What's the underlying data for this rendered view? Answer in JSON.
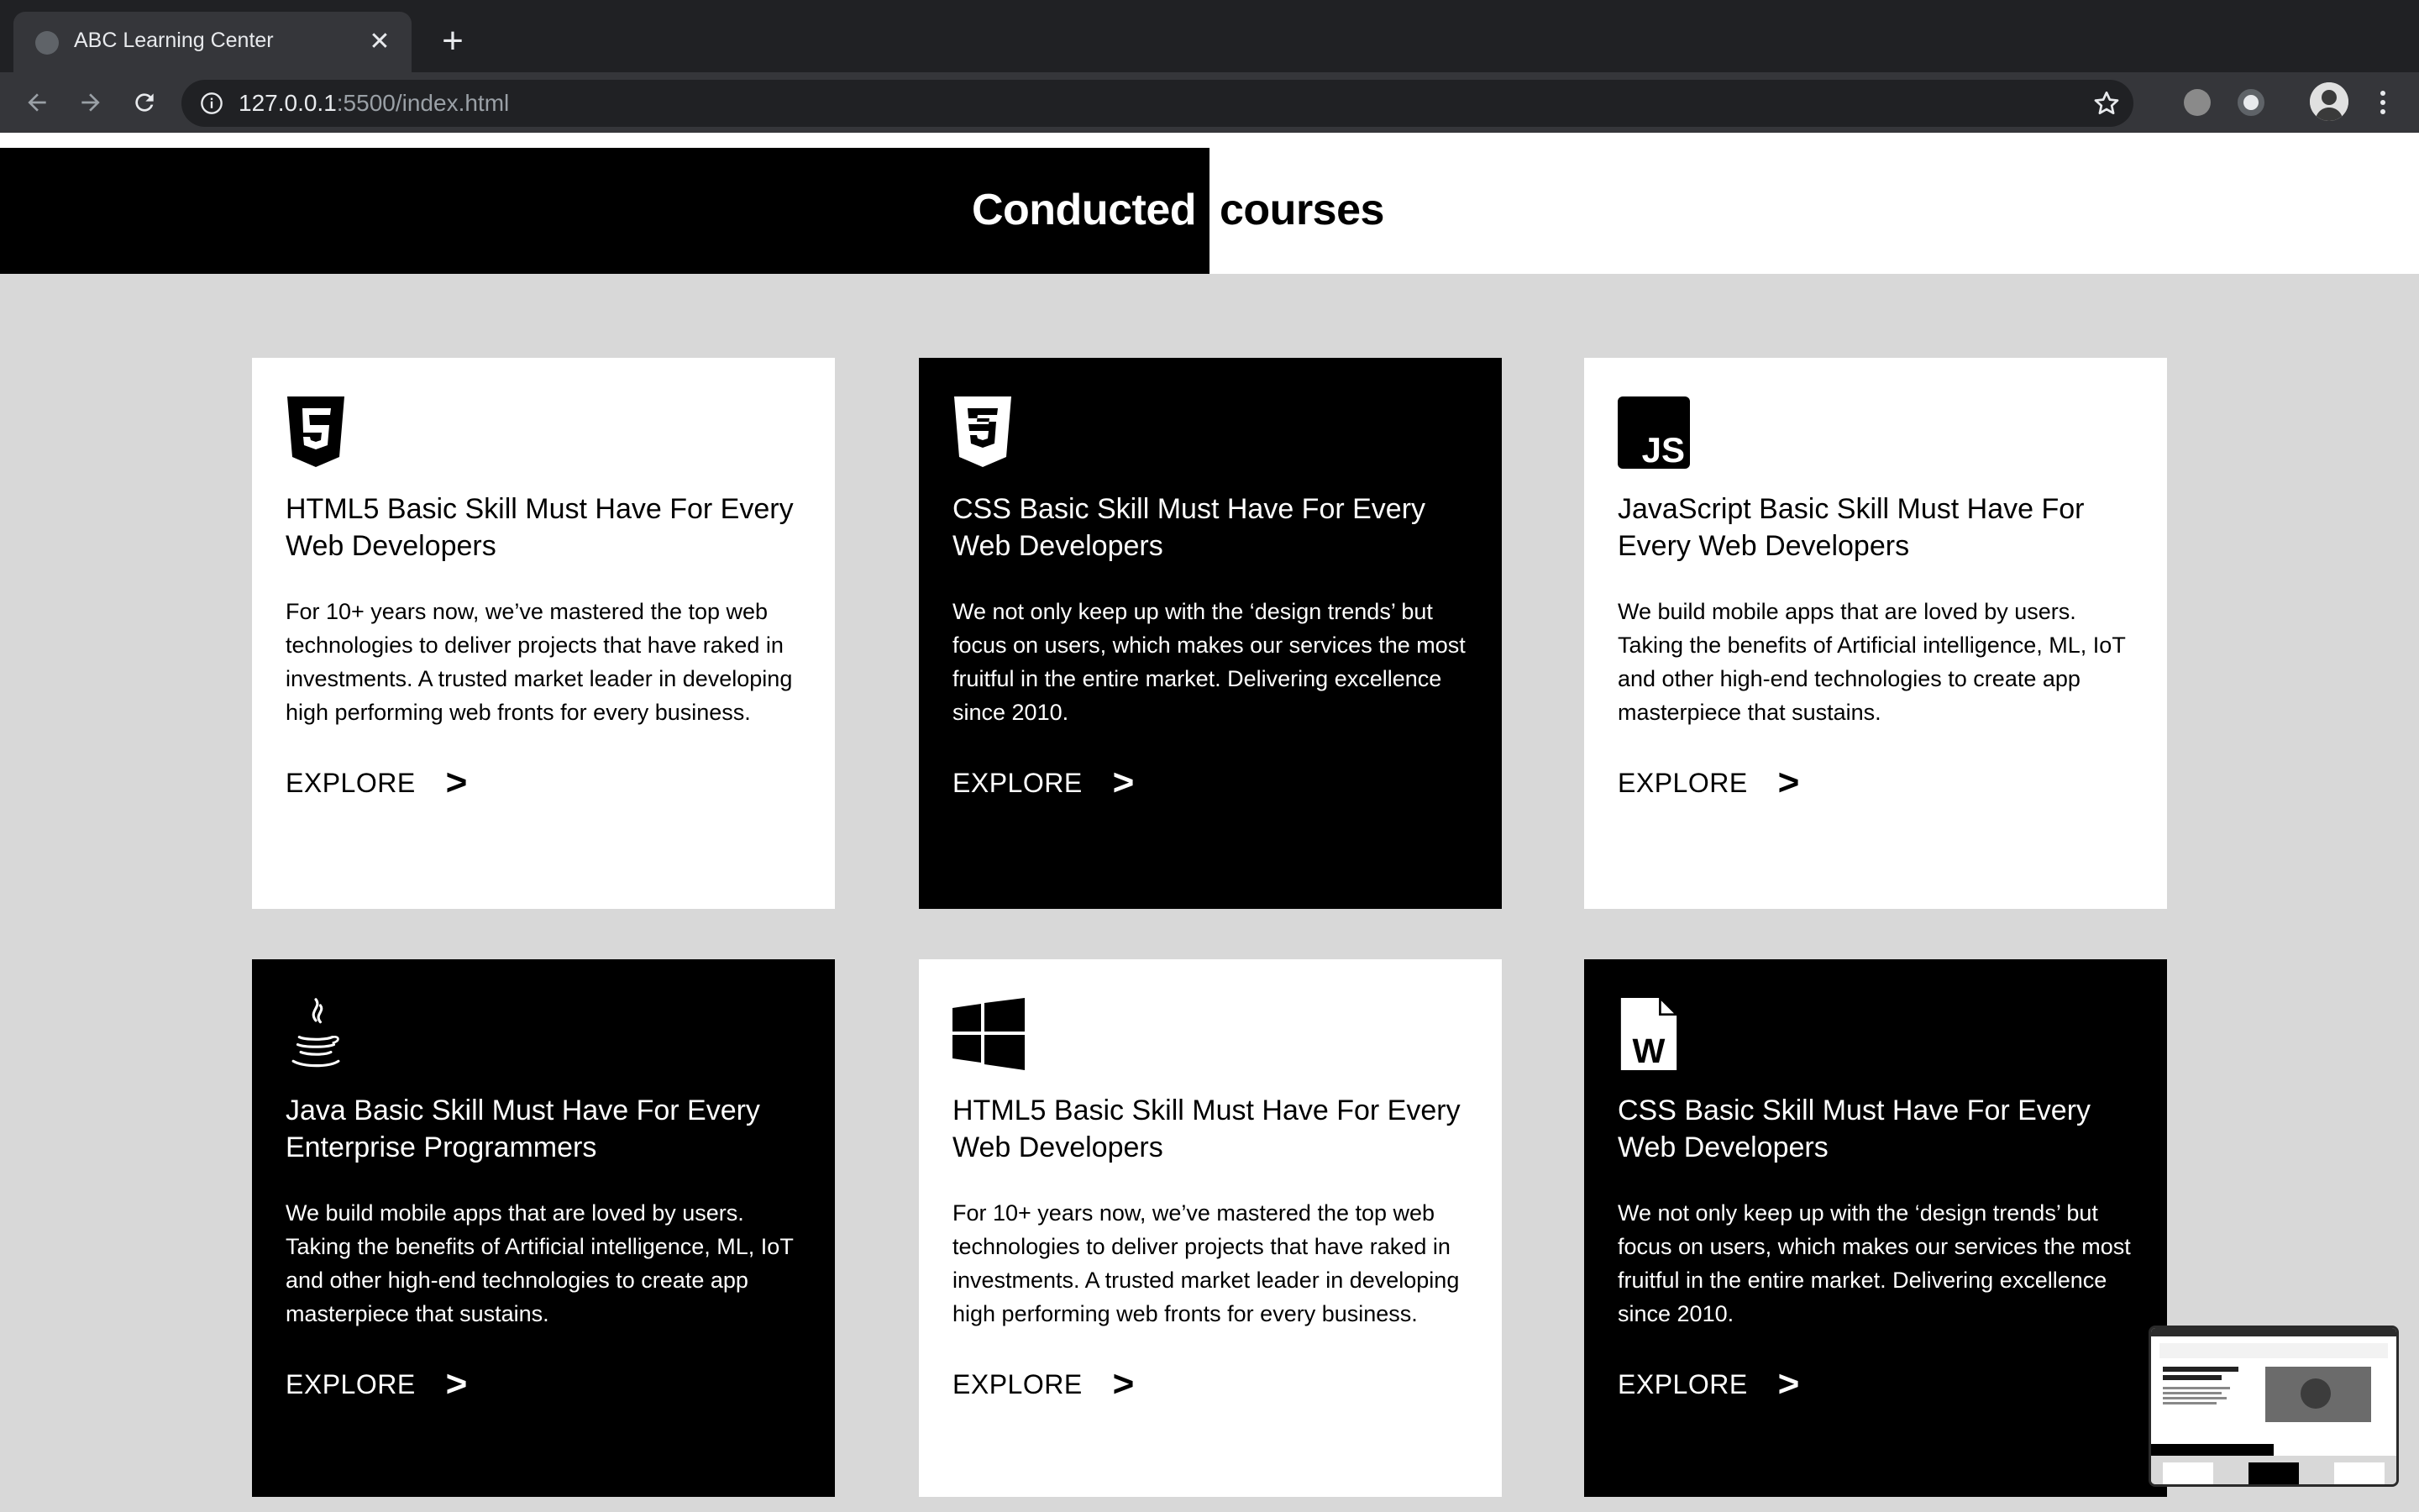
{
  "browser": {
    "tab_title": "ABC Learning Center",
    "tab_close": "✕",
    "new_tab": "+",
    "url_host": "127.0.0.1",
    "url_rest": ":5500/index.html"
  },
  "heading": {
    "left": "Conducted",
    "right": "courses"
  },
  "cards": [
    {
      "icon": "html5-icon",
      "title": "HTML5 Basic Skill Must Have For Every Web Developers",
      "description": "For 10+ years now, we’ve mastered the top web technologies to deliver projects that have raked in investments. A trusted market leader in developing high performing web fronts for every business.",
      "explore_label": "EXPLORE",
      "arrow": ">"
    },
    {
      "icon": "css3-icon",
      "title": "CSS Basic Skill Must Have For Every Web Developers",
      "description": "We not only keep up with the ‘design trends’ but focus on users, which makes our services the most fruitful in the entire market. Delivering excellence since 2010.",
      "explore_label": "EXPLORE",
      "arrow": ">"
    },
    {
      "icon": "javascript-icon",
      "icon_text": "JS",
      "title": "JavaScript Basic Skill Must Have For Every Web Developers",
      "description": "We build mobile apps that are loved by users. Taking the benefits of Artificial intelligence, ML, IoT and other high-end technologies to create app masterpiece that sustains.",
      "explore_label": "EXPLORE",
      "arrow": ">"
    },
    {
      "icon": "java-icon",
      "title": "Java Basic Skill Must Have For Every Enterprise Programmers",
      "description": "We build mobile apps that are loved by users. Taking the benefits of Artificial intelligence, ML, IoT and other high-end technologies to create app masterpiece that sustains.",
      "explore_label": "EXPLORE",
      "arrow": ">"
    },
    {
      "icon": "windows-icon",
      "title": "HTML5 Basic Skill Must Have For Every Web Developers",
      "description": "For 10+ years now, we’ve mastered the top web technologies to deliver projects that have raked in investments. A trusted market leader in developing high performing web fronts for every business.",
      "explore_label": "EXPLORE",
      "arrow": ">"
    },
    {
      "icon": "word-document-icon",
      "icon_text": "W",
      "title": "CSS Basic Skill Must Have For Every Web Developers",
      "description": "We not only keep up with the ‘design trends’ but focus on users, which makes our services the most fruitful in the entire market. Delivering excellence since 2010.",
      "explore_label": "EXPLORE",
      "arrow": ">"
    }
  ]
}
